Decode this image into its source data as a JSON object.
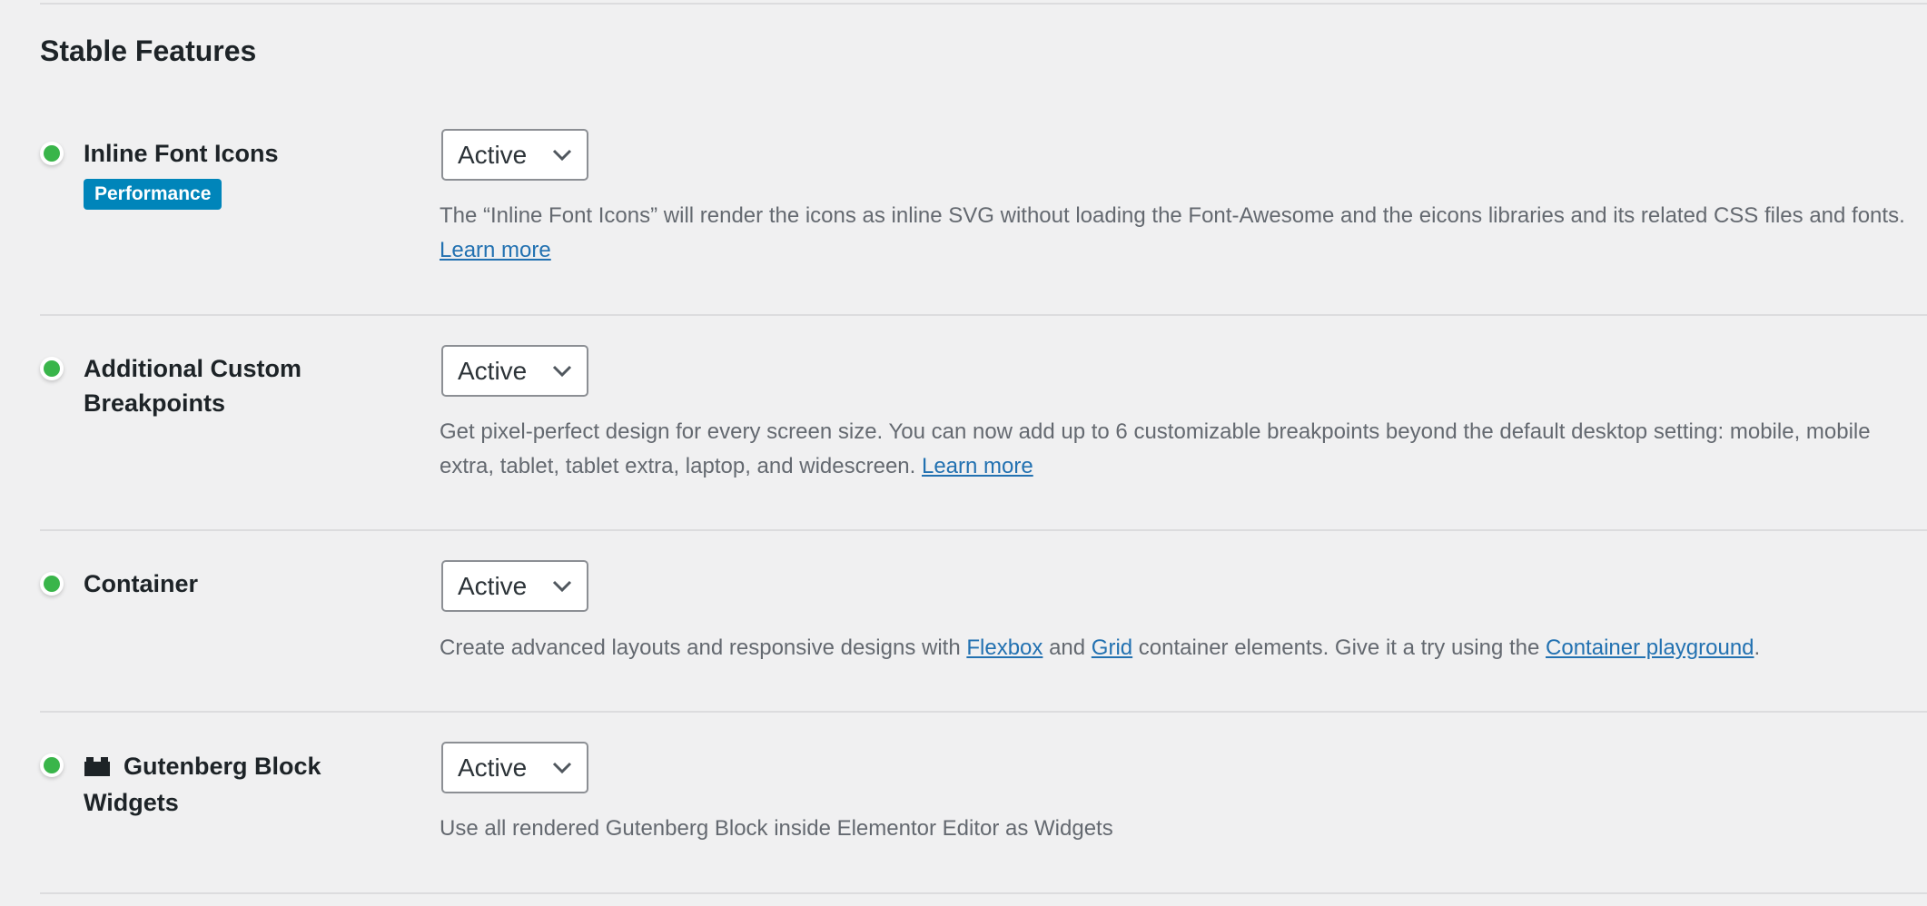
{
  "section": {
    "title": "Stable Features"
  },
  "colors": {
    "status_active": "#39b54a",
    "badge": "#0085ba",
    "link": "#2271b1"
  },
  "features": [
    {
      "title": "Inline Font Icons",
      "badge": "Performance",
      "status": "active",
      "select_value": "Active",
      "desc": {
        "text1": "The “Inline Font Icons” will render the icons as inline SVG without loading the Font-Awesome and the eicons libraries and its related CSS files and fonts. ",
        "link1": "Learn more"
      }
    },
    {
      "title": "Additional Custom Breakpoints",
      "status": "active",
      "select_value": "Active",
      "desc": {
        "text1": "Get pixel-perfect design for every screen size. You can now add up to 6 customizable breakpoints beyond the default desktop setting: mobile, mobile extra, tablet, tablet extra, laptop, and widescreen. ",
        "link1": "Learn more"
      }
    },
    {
      "title": "Container",
      "status": "active",
      "select_value": "Active",
      "desc": {
        "text1": "Create advanced layouts and responsive designs with ",
        "link1": "Flexbox",
        "text2": " and ",
        "link2": "Grid",
        "text3": " container elements. Give it a try using the ",
        "link3": "Container playground",
        "text4": "."
      }
    },
    {
      "title": "Gutenberg Block Widgets",
      "icon": "lego-block-icon",
      "status": "active",
      "select_value": "Active",
      "desc": {
        "text1": "Use all rendered Gutenberg Block inside Elementor Editor as Widgets"
      }
    }
  ]
}
